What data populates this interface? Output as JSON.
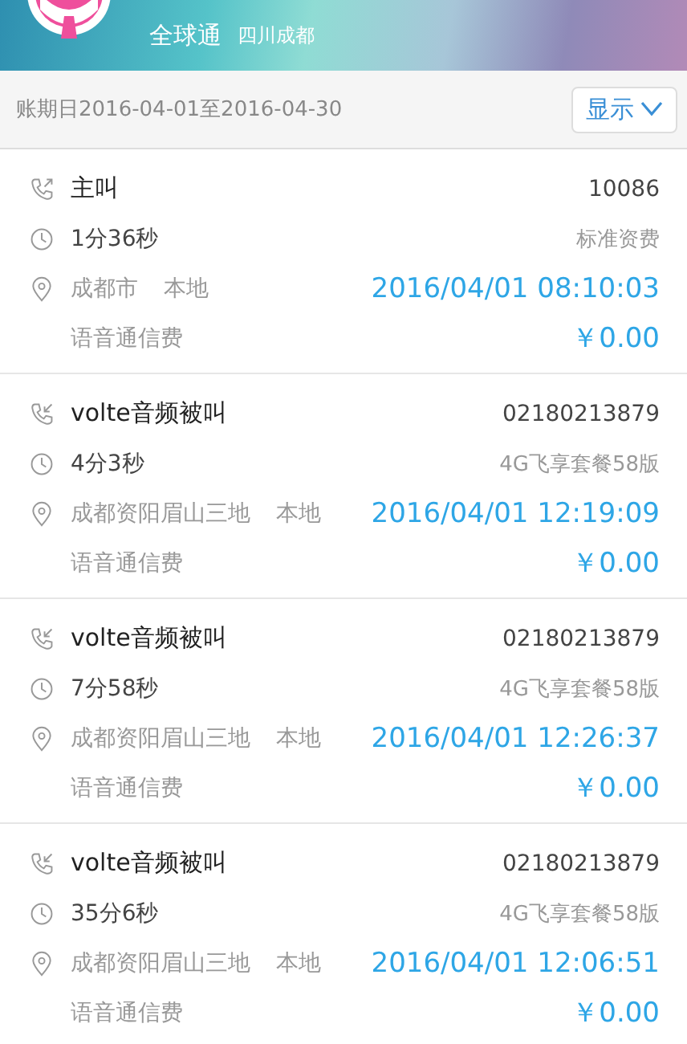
{
  "header": {
    "plan": "全球通",
    "region": "四川成都"
  },
  "period": {
    "label": "账期日2016-04-01至2016-04-30",
    "button": "显示"
  },
  "records": [
    {
      "kind": "outgoing",
      "type": "主叫",
      "number": "10086",
      "duration": "1分36秒",
      "package": "标准资费",
      "location": "成都市",
      "scope": "本地",
      "time": "2016/04/01 08:10:03",
      "fee_label": "语音通信费",
      "fee": "￥0.00"
    },
    {
      "kind": "incoming",
      "type": "volte音频被叫",
      "number": "02180213879",
      "duration": "4分3秒",
      "package": "4G飞享套餐58版",
      "location": "成都资阳眉山三地",
      "scope": "本地",
      "time": "2016/04/01 12:19:09",
      "fee_label": "语音通信费",
      "fee": "￥0.00"
    },
    {
      "kind": "incoming",
      "type": "volte音频被叫",
      "number": "02180213879",
      "duration": "7分58秒",
      "package": "4G飞享套餐58版",
      "location": "成都资阳眉山三地",
      "scope": "本地",
      "time": "2016/04/01 12:26:37",
      "fee_label": "语音通信费",
      "fee": "￥0.00"
    },
    {
      "kind": "incoming",
      "type": "volte音频被叫",
      "number": "02180213879",
      "duration": "35分6秒",
      "package": "4G飞享套餐58版",
      "location": "成都资阳眉山三地",
      "scope": "本地",
      "time": "2016/04/01 12:06:51",
      "fee_label": "语音通信费",
      "fee": "￥0.00"
    }
  ]
}
